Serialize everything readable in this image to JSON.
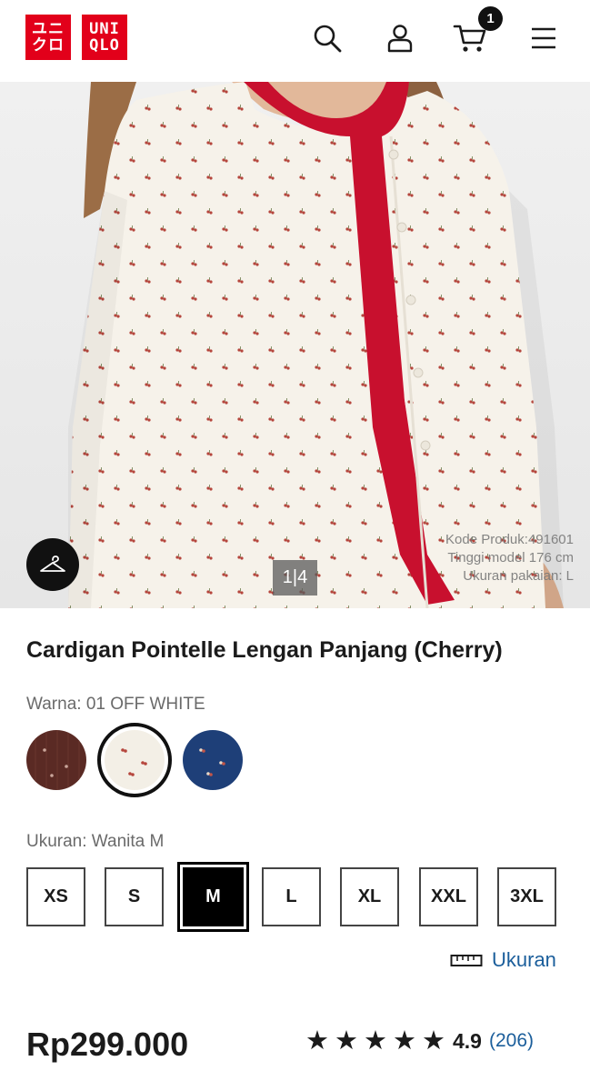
{
  "header": {
    "logo_top": "ユニ\nクロ",
    "logo_right": "UNI\nQLO",
    "cart_count": "1",
    "icons": [
      "search-icon",
      "user-icon",
      "cart-icon",
      "menu-icon"
    ]
  },
  "gallery": {
    "pager": "1|4",
    "model_info": {
      "product_code": "Kode Produk:491601",
      "model_height": "Tinggi model 176 cm",
      "size_worn": "Ukuran pakaian: L"
    }
  },
  "product": {
    "title": "Cardigan Pointelle Lengan Panjang (Cherry)",
    "color_label": "Warna: 01 OFF WHITE",
    "colors": [
      {
        "name": "brown",
        "hex": "#5a2a24",
        "selected": false
      },
      {
        "name": "off-white",
        "hex": "#f3efe6",
        "selected": true
      },
      {
        "name": "navy",
        "hex": "#1e3f78",
        "selected": false
      }
    ],
    "size_label": "Ukuran: Wanita M",
    "sizes": [
      "XS",
      "S",
      "M",
      "L",
      "XL",
      "XXL",
      "3XL"
    ],
    "selected_size": "M",
    "size_guide_label": "Ukuran",
    "price": "Rp299.000",
    "rating": {
      "stars": 5,
      "value": "4.9",
      "count": "(206)"
    }
  },
  "colors": {
    "brand_red": "#e2001a",
    "link_blue": "#1b5e9b",
    "text": "#1b1b1b"
  }
}
